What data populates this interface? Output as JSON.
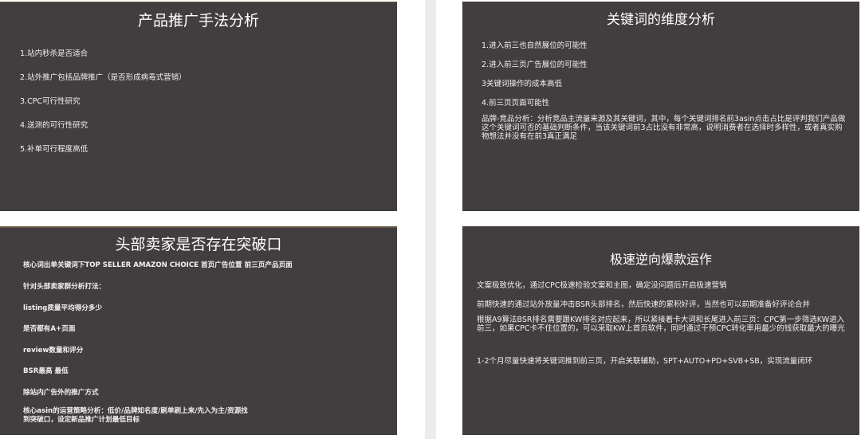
{
  "slides": [
    {
      "title": "产品推广手法分析",
      "items": [
        "1.站内秒杀是否适合",
        "2.站外推广包括品牌推广（是否形成病毒式营销）",
        "3.CPC可行性研究",
        "4.送测的可行性研究",
        "5.补单可行程度高低"
      ]
    },
    {
      "title": "关键词的维度分析",
      "items": [
        "1.进入前三也自然展位的可能性",
        "2.进入前三页广告展位的可能性",
        "3关键词操作的成本高低",
        "4.前三页页面可能性"
      ],
      "paragraph": "品牌-竞品分析：分析竞品主流量来源及其关键词，其中，每个关键词排名前3asin点击占比是评判我们产品做这个关键词可否的基础判断条件，当该关键词前3占比没有非常高，说明消费者在选择时多样性，或者真实购物想法并没有在前3真正满足"
    },
    {
      "title": "头部卖家是否存在突破口",
      "items": [
        "核心词出单关键词下TOP SELLER AMAZON CHOICE  首页广告位置  前三页产品页面",
        "针对头部卖家群分析打法：",
        "listing质量平均得分多少",
        "是否都有A+页面",
        "review数量和评分",
        "BSR最高 最低",
        "除站内广告外的推广方式"
      ],
      "footer": "核心asin的运营策略分析：低价/品牌知名度/刷单刷上来/先入为主/资源找到突破口，设定新品推广计划最低目标"
    },
    {
      "title": "极速逆向爆款运作",
      "items": [
        "文案极致优化，通过CPC极速检验文案和主图，确定没问题后开启极速营销",
        "前期快速的通过站外放量冲击BSR头部排名，然后快速的累积好评，当然也可以前期准备好评论合并"
      ],
      "para1": "根据A9算法BSR排名需要跟KW排名对应起来，所以紧接着卡大词和长尾进入前三页：CPC第一步筛选KW进入前三，如果CPC卡不住位置的，可以采取KW上首页软件，同时通过干预CPC转化率用最少的钱获取最大的曝光",
      "para2": "1-2个月尽量快速将关键词推到前三页，开启关联辅助，SPT+AUTO+PD+SVB+SB，实现流量闭环"
    }
  ]
}
